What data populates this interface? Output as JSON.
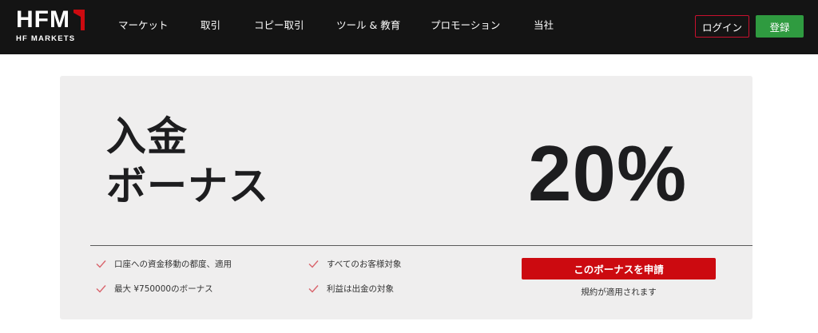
{
  "header": {
    "logo_text": "HFM",
    "logo_subtext": "HF MARKETS",
    "nav": [
      {
        "label": "マーケット"
      },
      {
        "label": "取引"
      },
      {
        "label": "コピー取引"
      },
      {
        "label": "ツール & 教育"
      },
      {
        "label": "プロモーション"
      },
      {
        "label": "当社"
      }
    ],
    "login_label": "ログイン",
    "register_label": "登録"
  },
  "promo": {
    "title_line1": "入金",
    "title_line2": "ボーナス",
    "percent": "20%",
    "features": [
      "口座への資金移動の都度、適用",
      "最大 ¥750000のボーナス",
      "すべてのお客様対象",
      "利益は出金の対象"
    ],
    "cta_label": "このボーナスを申請",
    "terms_text": "規約が適用されます"
  },
  "colors": {
    "header_bg": "#141414",
    "brand_red": "#cc0a10",
    "register_green": "#2f9b40",
    "card_bg": "#efeeee"
  }
}
